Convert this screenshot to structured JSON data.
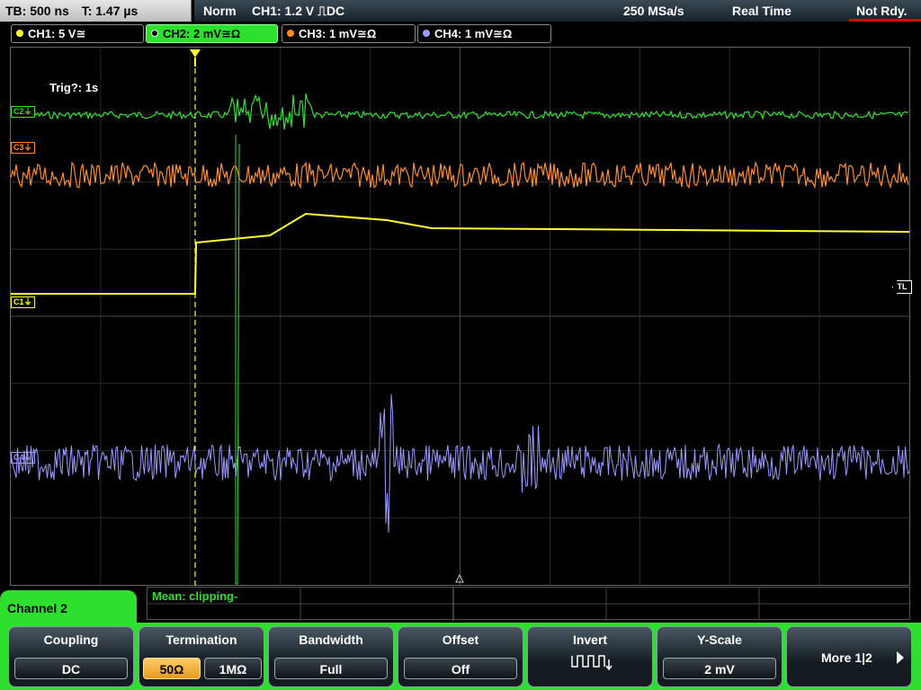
{
  "status": {
    "timebase": "TB: 500 ns",
    "trigger_time": "T: 1.47 µs",
    "trigger_mode": "Norm",
    "trigger_info": "CH1: 1.2 V ⎍DC",
    "sample_rate": "250 MSa/s",
    "acq_mode": "Real Time",
    "state": "Not Rdy."
  },
  "channels": [
    {
      "label": "CH1: 5 V≅",
      "color": "#ffff33"
    },
    {
      "label": "CH2: 2 mV≅Ω",
      "color": "#2ee02e"
    },
    {
      "label": "CH3: 1 mV≅Ω",
      "color": "#ff8c2a"
    },
    {
      "label": "CH4: 1 mV≅Ω",
      "color": "#9a9aff"
    }
  ],
  "screen": {
    "trigger_text": "Trig?: 1s",
    "markers": {
      "c1": "C1⏚",
      "c2": "C2⏚",
      "c3": "C3⏚",
      "c4": "C4⏚",
      "tl": "TL"
    }
  },
  "measurement": {
    "text": "Mean: clipping-"
  },
  "menu": {
    "title": "Channel 2",
    "coupling": {
      "label": "Coupling",
      "value": "DC"
    },
    "termination": {
      "label": "Termination",
      "options": [
        "50Ω",
        "1MΩ"
      ],
      "selected": "50Ω"
    },
    "bandwidth": {
      "label": "Bandwidth",
      "value": "Full"
    },
    "offset": {
      "label": "Offset",
      "value": "Off"
    },
    "invert": {
      "label": "Invert",
      "icon": "inverted-square-wave-icon"
    },
    "yscale": {
      "label": "Y-Scale",
      "value": "2 mV"
    },
    "more": {
      "label": "More 1|2",
      "icon": "arrow-right-icon"
    }
  },
  "colors": {
    "active_menu": "#2ee02e",
    "status_alert": "#e00000"
  }
}
